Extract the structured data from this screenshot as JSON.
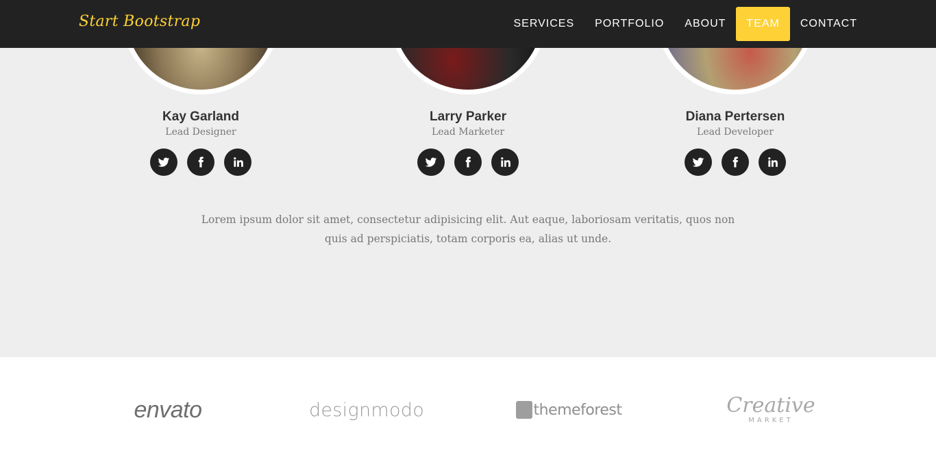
{
  "nav": {
    "brand": "Start Bootstrap",
    "links": [
      {
        "label": "SERVICES"
      },
      {
        "label": "PORTFOLIO"
      },
      {
        "label": "ABOUT"
      },
      {
        "label": "TEAM"
      },
      {
        "label": "CONTACT"
      }
    ],
    "active_link": "TEAM",
    "accent_color": "#fed136"
  },
  "team": {
    "members": [
      {
        "name": "Kay Garland",
        "role": "Lead Designer",
        "socials": [
          "twitter-icon",
          "facebook-icon",
          "linkedin-icon"
        ]
      },
      {
        "name": "Larry Parker",
        "role": "Lead Marketer",
        "socials": [
          "twitter-icon",
          "facebook-icon",
          "linkedin-icon"
        ]
      },
      {
        "name": "Diana Pertersen",
        "role": "Lead Developer",
        "socials": [
          "twitter-icon",
          "facebook-icon",
          "linkedin-icon"
        ]
      }
    ],
    "description": "Lorem ipsum dolor sit amet, consectetur adipisicing elit. Aut eaque, laboriosam veritatis, quos non quis ad perspiciatis, totam corporis ea, alias ut unde."
  },
  "clients": {
    "logos": [
      {
        "name": "envato",
        "text": "envato"
      },
      {
        "name": "designmodo",
        "text": "designmodo"
      },
      {
        "name": "themeforest",
        "text": "themeforest"
      },
      {
        "name": "creative-market",
        "text": "Creative",
        "subtext": "MARKET"
      }
    ]
  }
}
